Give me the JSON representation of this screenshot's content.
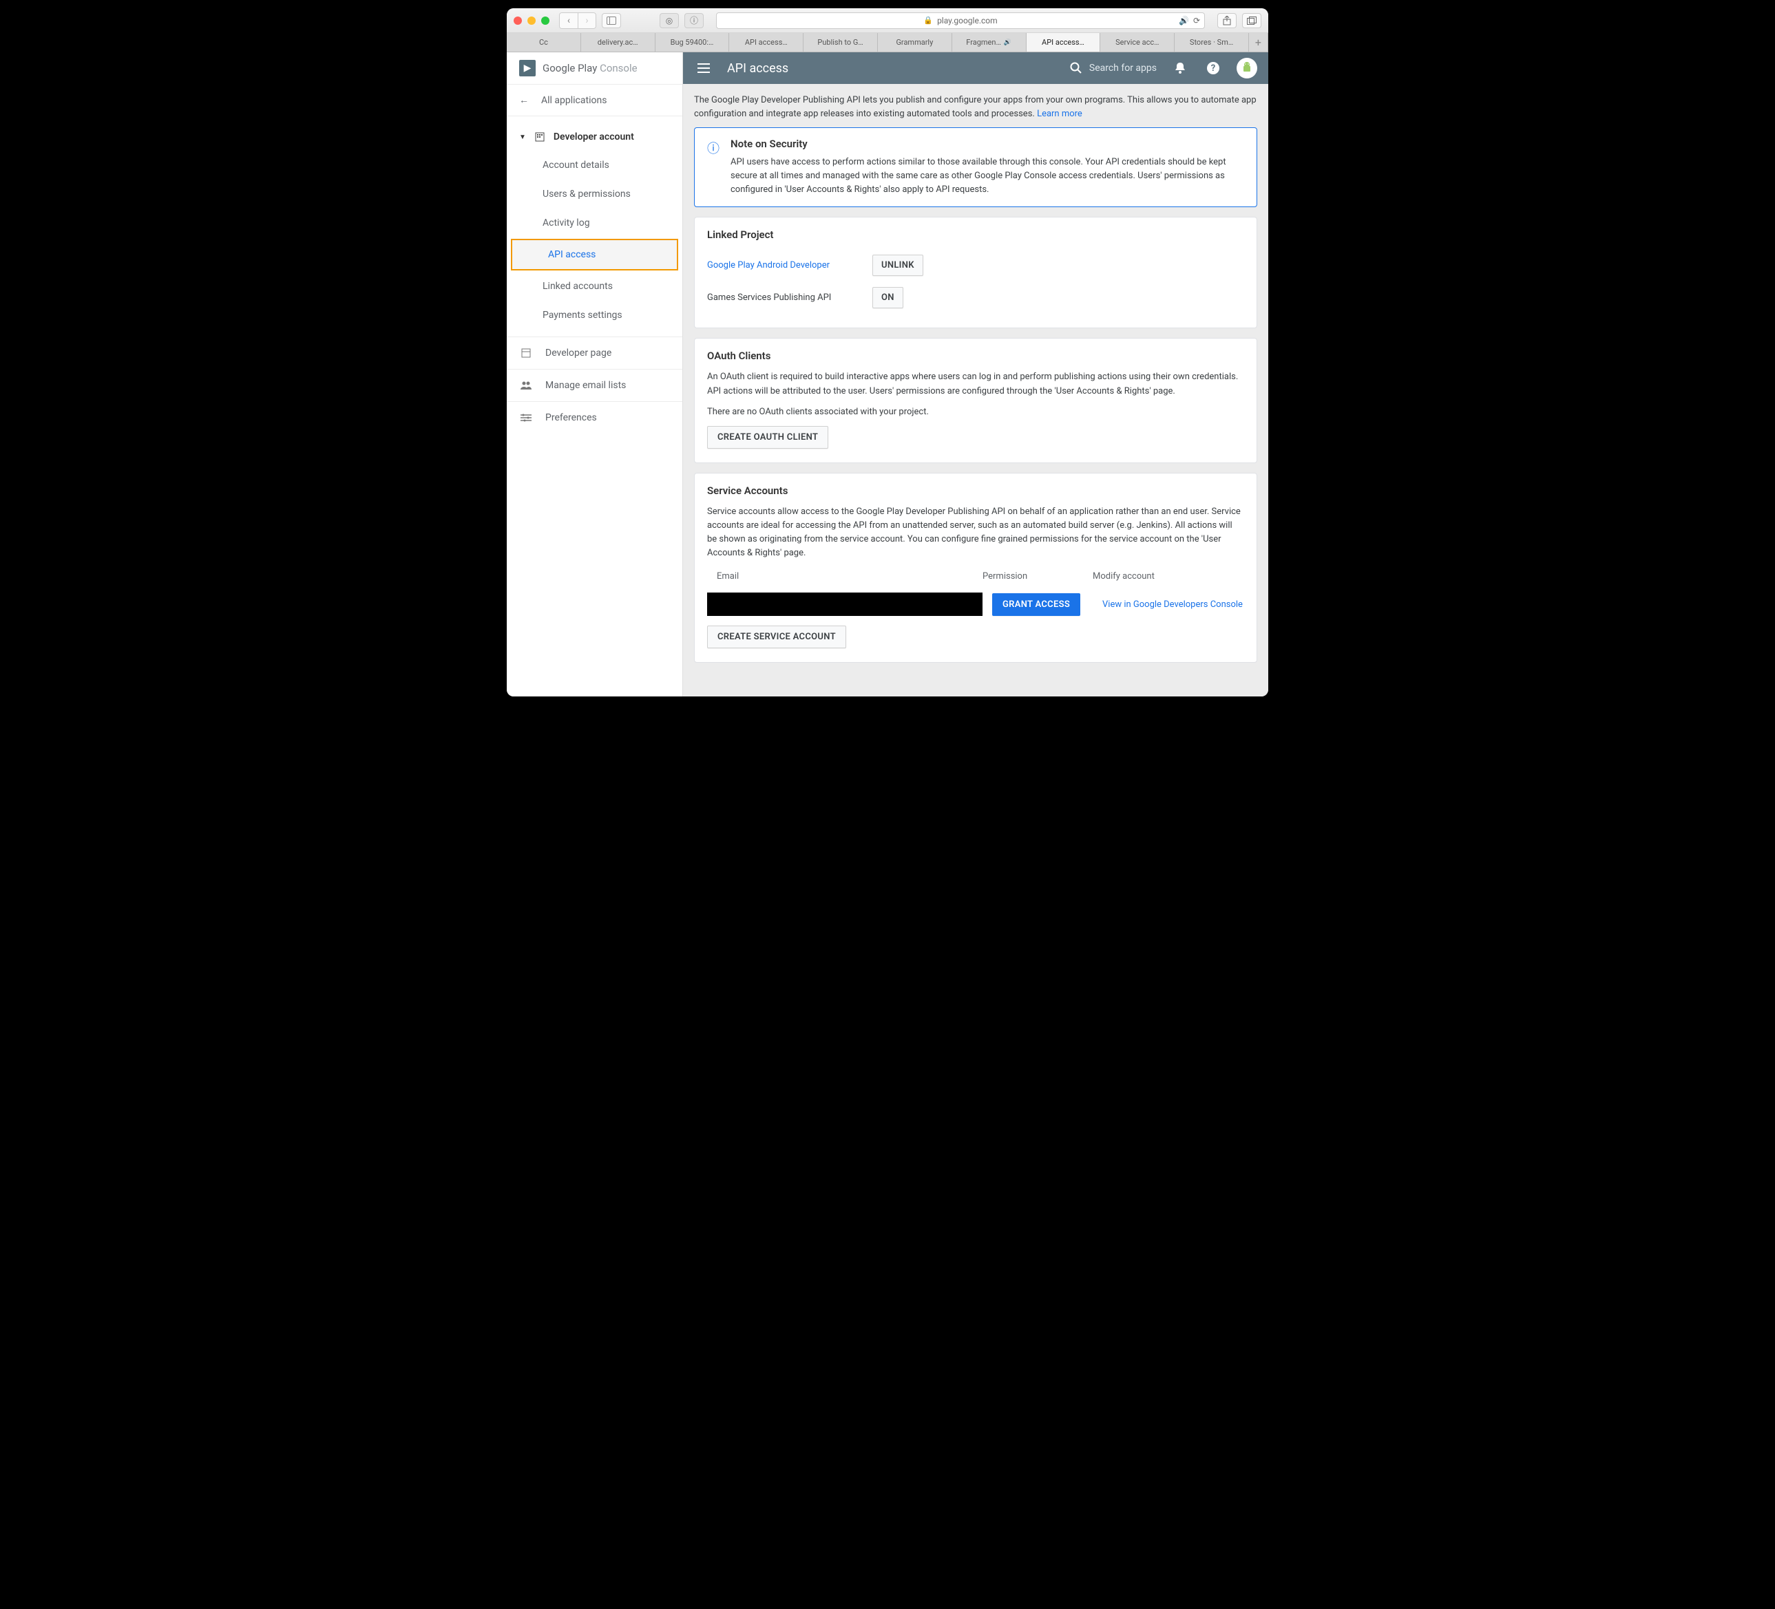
{
  "browser": {
    "url": "play.google.com",
    "tabs": [
      "Cc",
      "delivery.ac…",
      "Bug 59400:…",
      "API access…",
      "Publish to G…",
      "Grammarly",
      "Fragmen…",
      "API access…",
      "Service acc…",
      "Stores · Sm…"
    ],
    "active_tab_index": 7,
    "sound_tab_index": 6
  },
  "brand": {
    "google_play": "Google Play",
    "console": " Console"
  },
  "sidebar": {
    "all_apps": "All applications",
    "dev_account": "Developer account",
    "items": [
      "Account details",
      "Users & permissions",
      "Activity log",
      "API access",
      "Linked accounts",
      "Payments settings"
    ],
    "active_index": 3,
    "dev_page": "Developer page",
    "email_lists": "Manage email lists",
    "prefs": "Preferences"
  },
  "header": {
    "title": "API access",
    "search_placeholder": "Search for apps"
  },
  "intro": {
    "text": "The Google Play Developer Publishing API lets you publish and configure your apps from your own programs. This allows you to automate app configuration and integrate app releases into existing automated tools and processes. ",
    "link": "Learn more"
  },
  "note": {
    "title": "Note on Security",
    "body": "API users have access to perform actions similar to those available through this console. Your API credentials should be kept secure at all times and managed with the same care as other Google Play Console access credentials. Users' permissions as configured in 'User Accounts & Rights' also apply to API requests."
  },
  "linked": {
    "title": "Linked Project",
    "proj_link": "Google Play Android Developer",
    "unlink": "UNLINK",
    "games_label": "Games Services Publishing API",
    "games_btn": "ON"
  },
  "oauth": {
    "title": "OAuth Clients",
    "desc": "An OAuth client is required to build interactive apps where users can log in and perform publishing actions using their own credentials. API actions will be attributed to the user. Users' permissions are configured through the 'User Accounts & Rights' page.",
    "empty": "There are no OAuth clients associated with your project.",
    "create": "CREATE OAUTH CLIENT"
  },
  "sa": {
    "title": "Service Accounts",
    "desc": "Service accounts allow access to the Google Play Developer Publishing API on behalf of an application rather than an end user. Service accounts are ideal for accessing the API from an unattended server, such as an automated build server (e.g. Jenkins). All actions will be shown as originating from the service account. You can configure fine grained permissions for the service account on the 'User Accounts & Rights' page.",
    "col_email": "Email",
    "col_perm": "Permission",
    "col_mod": "Modify account",
    "grant": "GRANT ACCESS",
    "view_link": "View in Google Developers Console",
    "create": "CREATE SERVICE ACCOUNT"
  }
}
